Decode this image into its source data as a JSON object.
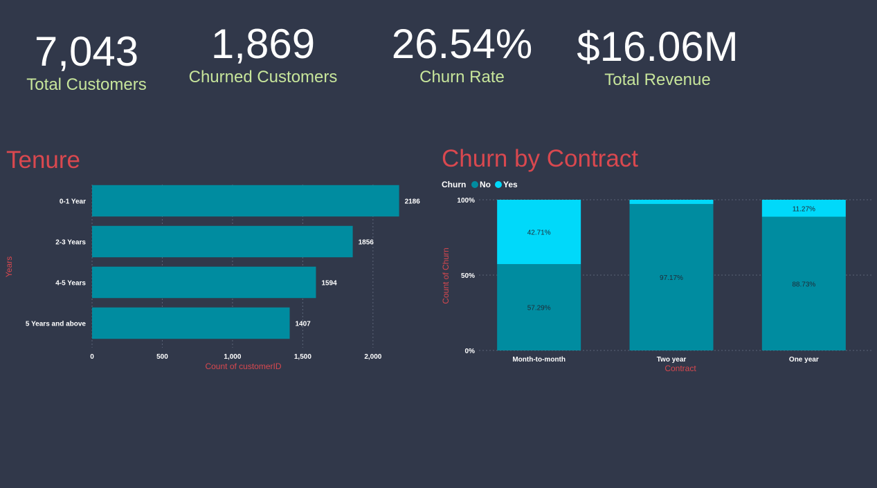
{
  "kpis": [
    {
      "value": "7,043",
      "label": "Total Customers"
    },
    {
      "value": "1,869",
      "label": "Churned Customers"
    },
    {
      "value": "26.54%",
      "label": "Churn Rate"
    },
    {
      "value": "$16.06M",
      "label": "Total Revenue"
    }
  ],
  "colors": {
    "background": "#31384a",
    "kpi_label": "#c7e59b",
    "title": "#d9484f",
    "no": "#008ca0",
    "yes": "#00d9fa"
  },
  "chart_data": [
    {
      "type": "bar",
      "orientation": "horizontal",
      "title": "Tenure",
      "categories": [
        "0-1 Year",
        "2-3 Years",
        "4-5 Years",
        "5 Years and above"
      ],
      "values": [
        2186,
        1856,
        1594,
        1407
      ],
      "data_labels": [
        "2186",
        "1856",
        "1594",
        "1407"
      ],
      "xlabel": "Count of customerID",
      "ylabel": "Years",
      "xlim": [
        0,
        2400
      ],
      "xticks": [
        0,
        500,
        1000,
        1500,
        2000
      ],
      "xtick_labels": [
        "0",
        "500",
        "1,000",
        "1,500",
        "2,000"
      ],
      "grid": true
    },
    {
      "type": "bar",
      "stacked": "100%",
      "title": "Churn by Contract",
      "legend_title": "Churn",
      "legend_position": "top-left",
      "categories": [
        "Month-to-month",
        "Two year",
        "One year"
      ],
      "series": [
        {
          "name": "No",
          "values": [
            57.29,
            97.17,
            88.73
          ],
          "labels": [
            "57.29%",
            "97.17%",
            "88.73%"
          ]
        },
        {
          "name": "Yes",
          "values": [
            42.71,
            2.83,
            11.27
          ],
          "labels": [
            "42.71%",
            "",
            "11.27%"
          ]
        }
      ],
      "xlabel": "Contract",
      "ylabel": "Count of Churn",
      "ylim": [
        0,
        100
      ],
      "yticks": [
        0,
        50,
        100
      ],
      "ytick_labels": [
        "0%",
        "50%",
        "100%"
      ],
      "grid": true
    }
  ]
}
